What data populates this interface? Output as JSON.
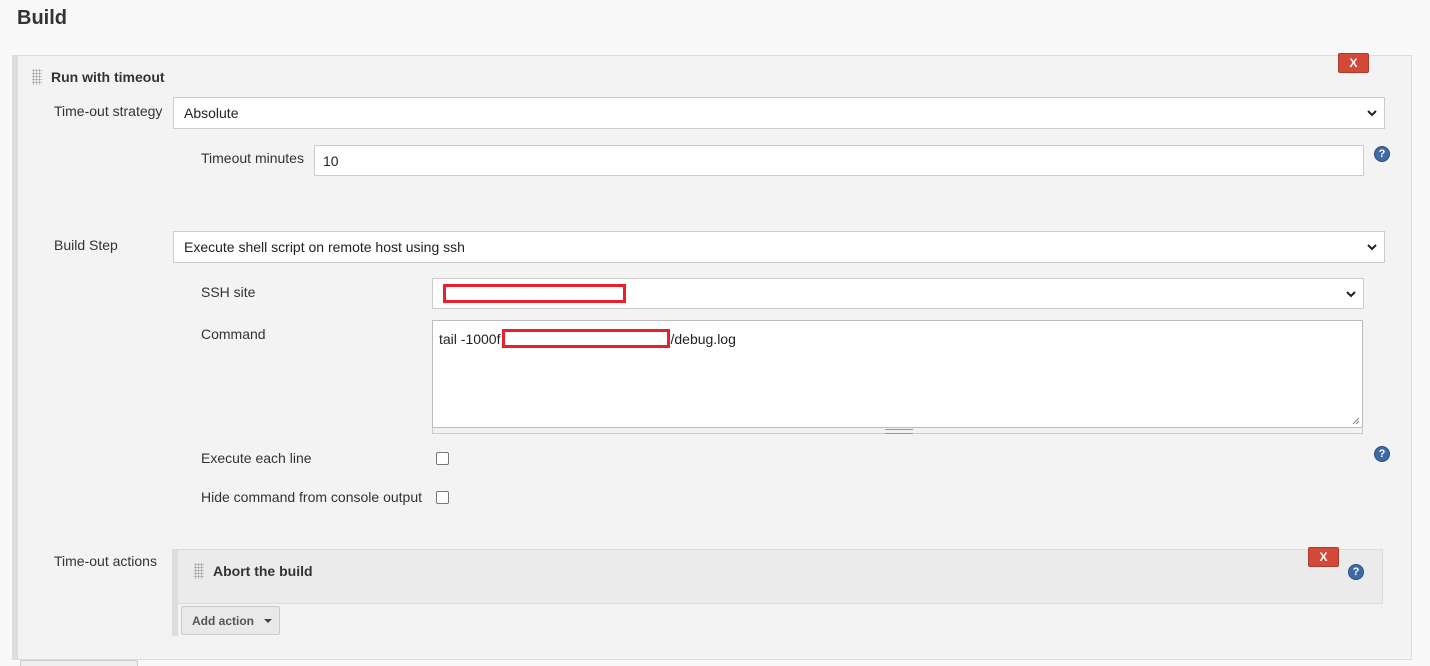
{
  "page": {
    "title": "Build"
  },
  "timeout_block": {
    "title": "Run with timeout",
    "delete_label": "X",
    "strategy": {
      "label": "Time-out strategy",
      "value": "Absolute"
    },
    "timeout_minutes": {
      "label": "Timeout minutes",
      "value": "10"
    }
  },
  "build_step": {
    "label": "Build Step",
    "value": "Execute shell script on remote host using ssh",
    "ssh_site": {
      "label": "SSH site",
      "value": ""
    },
    "command": {
      "label": "Command",
      "prefix": "tail -1000f",
      "suffix": "/debug.log"
    },
    "execute_each_line": {
      "label": "Execute each line",
      "checked": false
    },
    "hide_command": {
      "label": "Hide command from console output",
      "checked": false
    }
  },
  "timeout_actions": {
    "label": "Time-out actions",
    "action": {
      "title": "Abort the build",
      "delete_label": "X"
    },
    "add_action_label": "Add action"
  },
  "icons": {
    "help": "help-icon",
    "dropdown": "chevron-down-icon",
    "drag": "drag-handle-icon",
    "caret": "caret-down-icon"
  },
  "colors": {
    "delete_button": "#d24939",
    "help_icon": "#3f6ba4",
    "redaction": "#e8202a"
  }
}
